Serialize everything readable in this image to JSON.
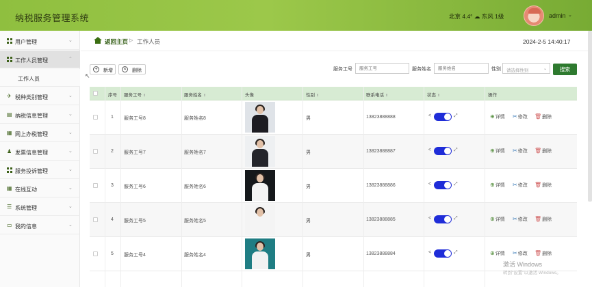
{
  "header": {
    "title": "纳税服务管理系统",
    "weather": "北京 4.4° ☁ 东风 1级",
    "user_name": "admin",
    "user_caret": "⌄"
  },
  "sidebar": {
    "items": [
      {
        "label": "用户管理"
      },
      {
        "label": "工作人员管理",
        "expanded": true
      },
      {
        "label": "工作人员",
        "sub": true
      },
      {
        "label": "税种类别管理"
      },
      {
        "label": "纳税信息管理"
      },
      {
        "label": "网上办税管理"
      },
      {
        "label": "发票信息管理"
      },
      {
        "label": "服务投诉管理"
      },
      {
        "label": "在线互动"
      },
      {
        "label": "系统管理"
      },
      {
        "label": "我的信息"
      }
    ],
    "chevron_down": "⌄",
    "chevron_up": "⌃"
  },
  "breadcrumb": {
    "home": "返回主页",
    "separator": "▷",
    "current": "工作人员"
  },
  "datetime": "2024-2-5 14:40:17",
  "toolbar": {
    "add_label": "新增",
    "delete_label": "删除",
    "add_icon": "+",
    "delete_icon": "×"
  },
  "search": {
    "staff_id_label": "服务工号",
    "staff_id_placeholder": "服务工号",
    "staff_name_label": "服务姓名",
    "staff_name_placeholder": "服务姓名",
    "gender_label": "性别",
    "gender_placeholder": "请选择性别",
    "button_label": "搜索"
  },
  "table": {
    "headers": [
      "序号",
      "服务工号",
      "服务姓名",
      "头像",
      "性别",
      "联系电话",
      "状态",
      "操作"
    ],
    "sort_glyph": "⇕",
    "rows": [
      {
        "index": "1",
        "staff_id": "服务工号8",
        "staff_name": "服务姓名8",
        "gender": "男",
        "phone": "13823888888",
        "status_on": true,
        "photo_bg": "#dfe3e8",
        "photo_body": "#1c1c22"
      },
      {
        "index": "2",
        "staff_id": "服务工号7",
        "staff_name": "服务姓名7",
        "gender": "男",
        "phone": "13823888887",
        "status_on": true,
        "photo_bg": "#eef0f2",
        "photo_body": "#24252b"
      },
      {
        "index": "3",
        "staff_id": "服务工号6",
        "staff_name": "服务姓名6",
        "gender": "男",
        "phone": "13823888886",
        "status_on": true,
        "photo_bg": "#15181b",
        "photo_body": "#f3f3f3"
      },
      {
        "index": "4",
        "staff_id": "服务工号5",
        "staff_name": "服务姓名5",
        "gender": "男",
        "phone": "13823888885",
        "status_on": true,
        "photo_bg": "#f4f4f4",
        "photo_body": "#f4f4f4"
      },
      {
        "index": "5",
        "staff_id": "服务工号4",
        "staff_name": "服务姓名4",
        "gender": "男",
        "phone": "13823888884",
        "status_on": true,
        "photo_bg": "#1f7d83",
        "photo_body": "#f2f2f2"
      }
    ],
    "toggle_left_glyph": "<",
    "toggle_right_glyph": "⤢",
    "action_detail": "详情",
    "action_edit": "修改",
    "action_delete": "删除",
    "detail_icon": "⊕",
    "edit_icon": "✂",
    "delete_icon": "🗑"
  },
  "watermark": {
    "line1": "激活 Windows",
    "line2": "转到\"设置\"以激活 Windows。"
  }
}
